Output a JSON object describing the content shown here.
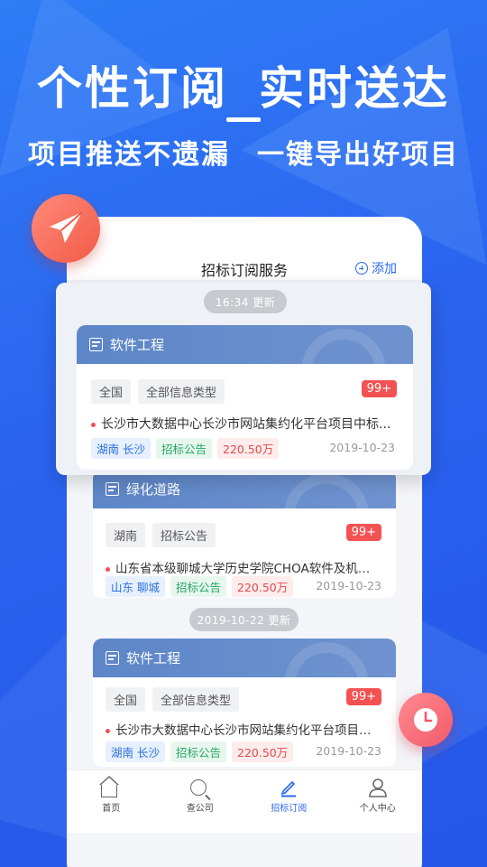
{
  "promo": {
    "headline_left": "个性订阅",
    "headline_right": "实时送达",
    "subline_left": "项目推送不遗漏",
    "subline_right": "一键导出好项目"
  },
  "app": {
    "title": "招标订阅服务",
    "add_label": "添加"
  },
  "groups": [
    {
      "time_label": "16:34  更新"
    },
    {
      "time_label": "2019-10-22 更新"
    }
  ],
  "cards": [
    {
      "title": "软件工程",
      "tags": [
        "全国",
        "全部信息类型"
      ],
      "badge": "99+",
      "item": "长沙市大数据中心长沙市网站集约化平台项目中标...",
      "region": "湖南 长沙",
      "category": "招标公告",
      "amount": "220.50万",
      "date": "2019-10-23"
    },
    {
      "title": "绿化道路",
      "tags": [
        "湖南",
        "招标公告"
      ],
      "badge": "99+",
      "item": "山东省本级聊城大学历史学院CHOA软件及机房工...",
      "region": "山东 聊城",
      "category": "招标公告",
      "amount": "220.50万",
      "date": "2019-10-23"
    },
    {
      "title": "软件工程",
      "tags": [
        "全国",
        "全部信息类型"
      ],
      "badge": "99+",
      "item": "长沙市大数据中心长沙市网站集约化平台项目中标...",
      "region": "湖南 长沙",
      "category": "招标公告",
      "amount": "220.50万",
      "date": "2019-10-23"
    }
  ],
  "nav": [
    {
      "label": "首页",
      "icon": "home-icon"
    },
    {
      "label": "查公司",
      "icon": "search-icon"
    },
    {
      "label": "招标订阅",
      "icon": "pen-icon",
      "active": true
    },
    {
      "label": "个人中心",
      "icon": "user-icon"
    }
  ],
  "colors": {
    "background": "#2a63ee",
    "accent": "#2b68f0",
    "card_header": "#6089c9",
    "badge": "#f35252"
  }
}
